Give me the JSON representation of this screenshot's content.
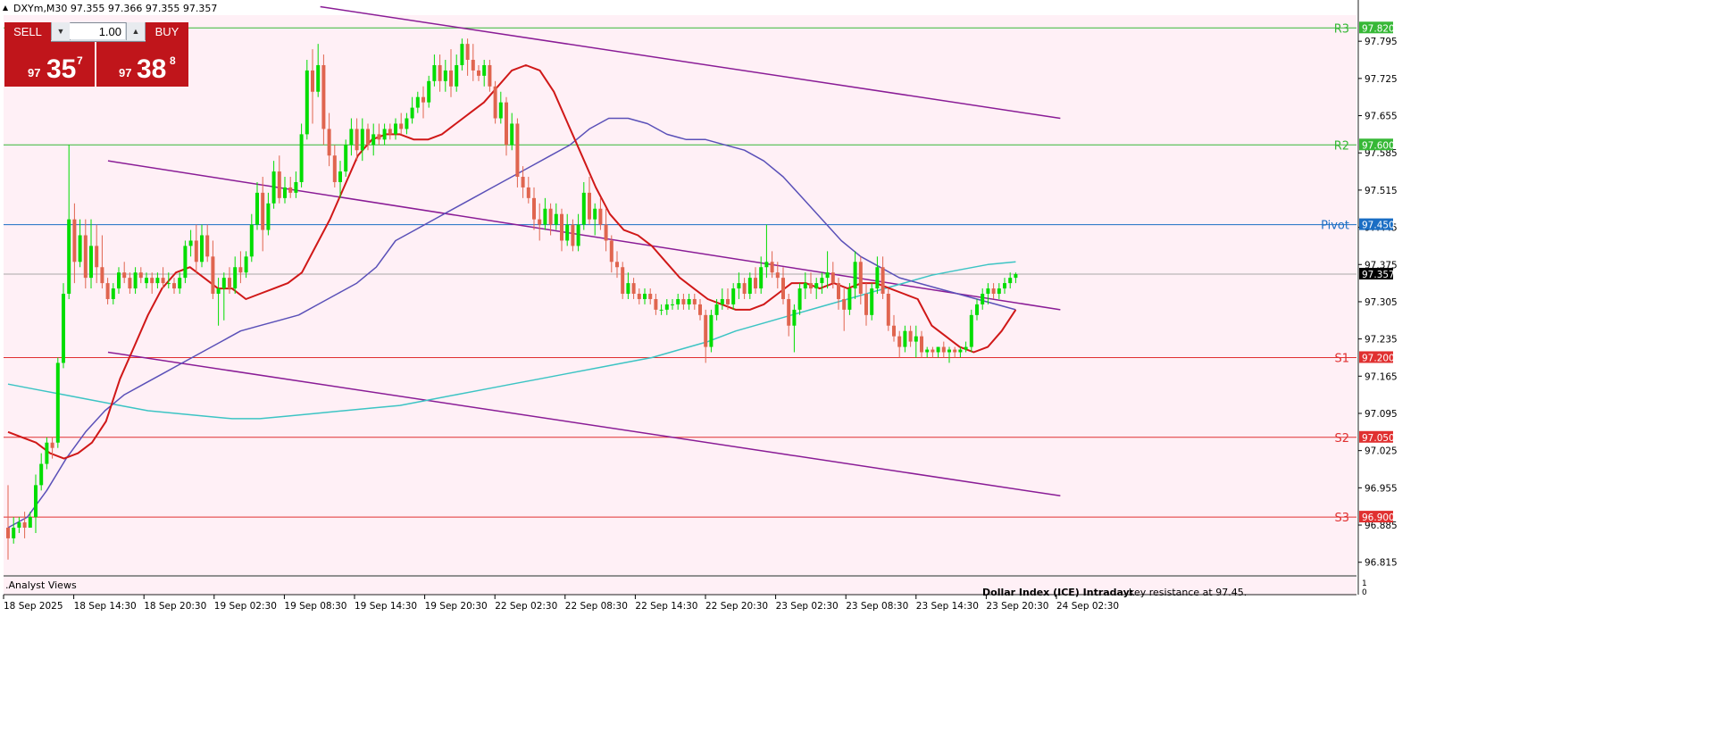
{
  "symbol_info": "DXYm,M30  97.355 97.366 97.355 97.357",
  "trade_panel": {
    "sell_label": "SELL",
    "buy_label": "BUY",
    "lot": "1.00",
    "sell_small": "97",
    "sell_big": "35",
    "sell_sup": "7",
    "buy_small": "97",
    "buy_big": "38",
    "buy_sup": "8"
  },
  "indicator_label": ".Analyst Views",
  "bottom_note": {
    "bold": "Dollar Index (ICE) Intraday:",
    "text": "key resistance at 97.45."
  },
  "colors": {
    "background": "#fff0f6",
    "bull": "#00dd00",
    "bear": "#e0654f",
    "ma_fast": "#d01818",
    "ma_mid": "#5a50b8",
    "ma_slow": "#3cc4c4",
    "channel": "#8a1c96",
    "resistance": "#36b836",
    "pivot": "#1a6ec4",
    "support": "#e03030"
  },
  "chart_data": {
    "type": "candlestick",
    "y_ticks": [
      97.795,
      97.725,
      97.655,
      97.585,
      97.515,
      97.445,
      97.375,
      97.305,
      97.235,
      97.165,
      97.095,
      97.025,
      96.955,
      96.885,
      96.815
    ],
    "ylim": [
      96.791,
      97.844
    ],
    "x_labels": [
      "18 Sep 2025",
      "18 Sep 14:30",
      "18 Sep 20:30",
      "19 Sep 02:30",
      "19 Sep 08:30",
      "19 Sep 14:30",
      "19 Sep 20:30",
      "22 Sep 02:30",
      "22 Sep 08:30",
      "22 Sep 14:30",
      "22 Sep 20:30",
      "23 Sep 02:30",
      "23 Sep 08:30",
      "23 Sep 14:30",
      "23 Sep 20:30",
      "24 Sep 02:30"
    ],
    "levels": [
      {
        "name": "R3",
        "value": 97.82,
        "price_label": "97.820",
        "kind": "resistance"
      },
      {
        "name": "R2",
        "value": 97.6,
        "price_label": "97.600",
        "kind": "resistance"
      },
      {
        "name": "Pivot",
        "value": 97.45,
        "price_label": "97.450",
        "kind": "pivot"
      },
      {
        "name": "S1",
        "value": 97.2,
        "price_label": "97.200",
        "kind": "support"
      },
      {
        "name": "S2",
        "value": 97.05,
        "price_label": "97.050",
        "kind": "support"
      },
      {
        "name": "S3",
        "value": 96.9,
        "price_label": "96.900",
        "kind": "support"
      }
    ],
    "current_price": 97.357,
    "current_price_label": "97.357",
    "candles": [
      [
        96.88,
        96.96,
        96.82,
        96.86
      ],
      [
        96.86,
        96.9,
        96.85,
        96.88
      ],
      [
        96.88,
        96.9,
        96.87,
        96.89
      ],
      [
        96.89,
        96.91,
        96.86,
        96.88
      ],
      [
        96.88,
        96.91,
        96.88,
        96.9
      ],
      [
        96.9,
        96.98,
        96.87,
        96.96
      ],
      [
        96.96,
        97.02,
        96.95,
        97.0
      ],
      [
        97.0,
        97.05,
        96.99,
        97.04
      ],
      [
        97.04,
        97.05,
        97.01,
        97.03
      ],
      [
        97.04,
        97.2,
        97.03,
        97.19
      ],
      [
        97.19,
        97.34,
        97.18,
        97.32
      ],
      [
        97.32,
        97.6,
        97.31,
        97.46
      ],
      [
        97.46,
        97.49,
        97.34,
        97.38
      ],
      [
        97.38,
        97.46,
        97.37,
        97.43
      ],
      [
        97.43,
        97.46,
        97.33,
        97.35
      ],
      [
        97.35,
        97.46,
        97.33,
        97.41
      ],
      [
        97.41,
        97.45,
        97.34,
        97.37
      ],
      [
        97.37,
        97.43,
        97.33,
        97.34
      ],
      [
        97.34,
        97.35,
        97.3,
        97.31
      ],
      [
        97.31,
        97.34,
        97.3,
        97.33
      ],
      [
        97.33,
        97.37,
        97.32,
        97.36
      ],
      [
        97.36,
        97.38,
        97.34,
        97.35
      ],
      [
        97.35,
        97.36,
        97.32,
        97.33
      ],
      [
        97.33,
        97.37,
        97.32,
        97.36
      ],
      [
        97.36,
        97.37,
        97.34,
        97.35
      ],
      [
        97.34,
        97.36,
        97.33,
        97.35
      ],
      [
        97.35,
        97.36,
        97.32,
        97.34
      ],
      [
        97.34,
        97.36,
        97.33,
        97.35
      ],
      [
        97.35,
        97.37,
        97.33,
        97.34
      ],
      [
        97.34,
        97.36,
        97.33,
        97.34
      ],
      [
        97.34,
        97.35,
        97.32,
        97.33
      ],
      [
        97.33,
        97.36,
        97.32,
        97.35
      ],
      [
        97.35,
        97.42,
        97.34,
        97.41
      ],
      [
        97.41,
        97.44,
        97.39,
        97.42
      ],
      [
        97.42,
        97.45,
        97.36,
        97.38
      ],
      [
        97.38,
        97.45,
        97.37,
        97.43
      ],
      [
        97.43,
        97.45,
        97.38,
        97.39
      ],
      [
        97.39,
        97.42,
        97.31,
        97.32
      ],
      [
        97.32,
        97.35,
        97.26,
        97.33
      ],
      [
        97.33,
        97.36,
        97.27,
        97.35
      ],
      [
        97.35,
        97.37,
        97.32,
        97.33
      ],
      [
        97.33,
        97.39,
        97.32,
        97.37
      ],
      [
        97.37,
        97.4,
        97.34,
        97.36
      ],
      [
        97.36,
        97.4,
        97.35,
        97.39
      ],
      [
        97.39,
        97.47,
        97.38,
        97.45
      ],
      [
        97.45,
        97.53,
        97.44,
        97.51
      ],
      [
        97.51,
        97.54,
        97.4,
        97.44
      ],
      [
        97.44,
        97.51,
        97.43,
        97.49
      ],
      [
        97.49,
        97.57,
        97.48,
        97.55
      ],
      [
        97.55,
        97.58,
        97.49,
        97.5
      ],
      [
        97.5,
        97.54,
        97.49,
        97.52
      ],
      [
        97.52,
        97.54,
        97.5,
        97.51
      ],
      [
        97.51,
        97.55,
        97.5,
        97.53
      ],
      [
        97.53,
        97.64,
        97.52,
        97.62
      ],
      [
        97.62,
        97.76,
        97.61,
        97.74
      ],
      [
        97.74,
        97.78,
        97.64,
        97.7
      ],
      [
        97.7,
        97.79,
        97.69,
        97.75
      ],
      [
        97.75,
        97.77,
        97.6,
        97.63
      ],
      [
        97.63,
        97.66,
        97.56,
        97.58
      ],
      [
        97.58,
        97.6,
        97.52,
        97.53
      ],
      [
        97.53,
        97.57,
        97.5,
        97.55
      ],
      [
        97.55,
        97.61,
        97.54,
        97.6
      ],
      [
        97.6,
        97.65,
        97.58,
        97.63
      ],
      [
        97.63,
        97.65,
        97.57,
        97.59
      ],
      [
        97.59,
        97.65,
        97.57,
        97.63
      ],
      [
        97.63,
        97.64,
        97.59,
        97.6
      ],
      [
        97.6,
        97.64,
        97.58,
        97.62
      ],
      [
        97.62,
        97.64,
        97.6,
        97.61
      ],
      [
        97.61,
        97.64,
        97.6,
        97.63
      ],
      [
        97.63,
        97.64,
        97.61,
        97.62
      ],
      [
        97.62,
        97.65,
        97.61,
        97.64
      ],
      [
        97.64,
        97.66,
        97.62,
        97.63
      ],
      [
        97.63,
        97.66,
        97.62,
        97.65
      ],
      [
        97.65,
        97.69,
        97.64,
        97.67
      ],
      [
        97.67,
        97.7,
        97.66,
        97.69
      ],
      [
        97.69,
        97.71,
        97.65,
        97.68
      ],
      [
        97.68,
        97.73,
        97.67,
        97.72
      ],
      [
        97.72,
        97.77,
        97.71,
        97.75
      ],
      [
        97.75,
        97.77,
        97.7,
        97.72
      ],
      [
        97.72,
        97.76,
        97.7,
        97.74
      ],
      [
        97.74,
        97.78,
        97.69,
        97.71
      ],
      [
        97.71,
        97.77,
        97.7,
        97.75
      ],
      [
        97.75,
        97.8,
        97.74,
        97.79
      ],
      [
        97.79,
        97.8,
        97.73,
        97.76
      ],
      [
        97.76,
        97.79,
        97.72,
        97.74
      ],
      [
        97.74,
        97.75,
        97.72,
        97.73
      ],
      [
        97.73,
        97.76,
        97.71,
        97.75
      ],
      [
        97.75,
        97.76,
        97.7,
        97.71
      ],
      [
        97.71,
        97.72,
        97.64,
        97.65
      ],
      [
        97.65,
        97.7,
        97.64,
        97.68
      ],
      [
        97.68,
        97.69,
        97.58,
        97.6
      ],
      [
        97.6,
        97.66,
        97.59,
        97.64
      ],
      [
        97.64,
        97.65,
        97.52,
        97.54
      ],
      [
        97.54,
        97.56,
        97.5,
        97.52
      ],
      [
        97.52,
        97.54,
        97.49,
        97.5
      ],
      [
        97.5,
        97.52,
        97.44,
        97.46
      ],
      [
        97.46,
        97.49,
        97.42,
        97.45
      ],
      [
        97.45,
        97.5,
        97.44,
        97.48
      ],
      [
        97.48,
        97.49,
        97.43,
        97.45
      ],
      [
        97.45,
        97.49,
        97.44,
        97.47
      ],
      [
        97.47,
        97.48,
        97.4,
        97.42
      ],
      [
        97.42,
        97.47,
        97.41,
        97.45
      ],
      [
        97.45,
        97.46,
        97.4,
        97.41
      ],
      [
        97.41,
        97.47,
        97.4,
        97.45
      ],
      [
        97.45,
        97.53,
        97.44,
        97.51
      ],
      [
        97.51,
        97.54,
        97.45,
        97.46
      ],
      [
        97.46,
        97.49,
        97.43,
        97.48
      ],
      [
        97.48,
        97.5,
        97.44,
        97.45
      ],
      [
        97.45,
        97.48,
        97.4,
        97.42
      ],
      [
        97.42,
        97.43,
        97.36,
        97.38
      ],
      [
        97.38,
        97.4,
        97.35,
        97.37
      ],
      [
        97.37,
        97.38,
        97.31,
        97.32
      ],
      [
        97.32,
        97.36,
        97.31,
        97.34
      ],
      [
        97.34,
        97.35,
        97.31,
        97.32
      ],
      [
        97.32,
        97.33,
        97.3,
        97.31
      ],
      [
        97.31,
        97.33,
        97.3,
        97.32
      ],
      [
        97.32,
        97.33,
        97.3,
        97.31
      ],
      [
        97.31,
        97.32,
        97.28,
        97.29
      ],
      [
        97.29,
        97.3,
        97.28,
        97.29
      ],
      [
        97.29,
        97.31,
        97.28,
        97.3
      ],
      [
        97.3,
        97.31,
        97.29,
        97.3
      ],
      [
        97.3,
        97.32,
        97.29,
        97.31
      ],
      [
        97.31,
        97.32,
        97.29,
        97.3
      ],
      [
        97.3,
        97.32,
        97.29,
        97.31
      ],
      [
        97.31,
        97.32,
        97.29,
        97.3
      ],
      [
        97.3,
        97.31,
        97.27,
        97.28
      ],
      [
        97.28,
        97.29,
        97.19,
        97.22
      ],
      [
        97.22,
        97.29,
        97.21,
        97.28
      ],
      [
        97.28,
        97.31,
        97.27,
        97.3
      ],
      [
        97.3,
        97.33,
        97.29,
        97.31
      ],
      [
        97.31,
        97.33,
        97.29,
        97.3
      ],
      [
        97.3,
        97.34,
        97.29,
        97.33
      ],
      [
        97.33,
        97.36,
        97.31,
        97.34
      ],
      [
        97.34,
        97.35,
        97.31,
        97.32
      ],
      [
        97.32,
        97.36,
        97.31,
        97.35
      ],
      [
        97.35,
        97.37,
        97.32,
        97.33
      ],
      [
        97.33,
        97.39,
        97.32,
        97.37
      ],
      [
        97.37,
        97.45,
        97.35,
        97.38
      ],
      [
        97.38,
        97.4,
        97.35,
        97.36
      ],
      [
        97.36,
        97.38,
        97.33,
        97.35
      ],
      [
        97.35,
        97.37,
        97.3,
        97.31
      ],
      [
        97.31,
        97.32,
        97.24,
        97.26
      ],
      [
        97.26,
        97.3,
        97.21,
        97.29
      ],
      [
        97.29,
        97.34,
        97.28,
        97.33
      ],
      [
        97.33,
        97.36,
        97.31,
        97.34
      ],
      [
        97.34,
        97.36,
        97.32,
        97.33
      ],
      [
        97.33,
        97.35,
        97.31,
        97.34
      ],
      [
        97.34,
        97.36,
        97.32,
        97.35
      ],
      [
        97.35,
        97.4,
        97.33,
        97.36
      ],
      [
        97.36,
        97.38,
        97.33,
        97.34
      ],
      [
        97.34,
        97.35,
        97.29,
        97.31
      ],
      [
        97.31,
        97.33,
        97.25,
        97.29
      ],
      [
        97.29,
        97.34,
        97.28,
        97.33
      ],
      [
        97.33,
        97.4,
        97.31,
        97.38
      ],
      [
        97.38,
        97.39,
        97.3,
        97.32
      ],
      [
        97.32,
        97.34,
        97.26,
        97.28
      ],
      [
        97.28,
        97.34,
        97.27,
        97.33
      ],
      [
        97.33,
        97.39,
        97.32,
        97.37
      ],
      [
        97.37,
        97.39,
        97.31,
        97.32
      ],
      [
        97.32,
        97.33,
        97.25,
        97.26
      ],
      [
        97.26,
        97.28,
        97.23,
        97.24
      ],
      [
        97.24,
        97.25,
        97.2,
        97.22
      ],
      [
        97.22,
        97.26,
        97.21,
        97.25
      ],
      [
        97.25,
        97.26,
        97.22,
        97.23
      ],
      [
        97.23,
        97.26,
        97.2,
        97.24
      ],
      [
        97.24,
        97.25,
        97.2,
        97.21
      ],
      [
        97.21,
        97.22,
        97.2,
        97.215
      ],
      [
        97.215,
        97.22,
        97.2,
        97.21
      ],
      [
        97.21,
        97.22,
        97.2,
        97.22
      ],
      [
        97.22,
        97.23,
        97.2,
        97.21
      ],
      [
        97.21,
        97.22,
        97.19,
        97.215
      ],
      [
        97.215,
        97.22,
        97.2,
        97.21
      ],
      [
        97.21,
        97.22,
        97.2,
        97.215
      ],
      [
        97.215,
        97.23,
        97.21,
        97.22
      ],
      [
        97.22,
        97.29,
        97.21,
        97.28
      ],
      [
        97.28,
        97.31,
        97.27,
        97.3
      ],
      [
        97.3,
        97.33,
        97.29,
        97.32
      ],
      [
        97.32,
        97.34,
        97.3,
        97.33
      ],
      [
        97.33,
        97.34,
        97.31,
        97.32
      ],
      [
        97.32,
        97.34,
        97.31,
        97.33
      ],
      [
        97.33,
        97.35,
        97.32,
        97.34
      ],
      [
        97.34,
        97.36,
        97.33,
        97.35
      ],
      [
        97.35,
        97.36,
        97.34,
        97.357
      ]
    ],
    "indicators": {
      "ma_fast": [
        97.06,
        97.05,
        97.04,
        97.02,
        97.01,
        97.02,
        97.04,
        97.08,
        97.16,
        97.22,
        97.28,
        97.33,
        97.36,
        97.37,
        97.35,
        97.33,
        97.33,
        97.31,
        97.32,
        97.33,
        97.34,
        97.36,
        97.41,
        97.46,
        97.52,
        97.58,
        97.61,
        97.62,
        97.62,
        97.61,
        97.61,
        97.62,
        97.64,
        97.66,
        97.68,
        97.71,
        97.74,
        97.75,
        97.74,
        97.7,
        97.64,
        97.58,
        97.52,
        97.47,
        97.44,
        97.43,
        97.41,
        97.38,
        97.35,
        97.33,
        97.31,
        97.3,
        97.29,
        97.29,
        97.3,
        97.32,
        97.34,
        97.34,
        97.33,
        97.34,
        97.33,
        97.34,
        97.34,
        97.33,
        97.32,
        97.31,
        97.26,
        97.24,
        97.22,
        97.21,
        97.22,
        97.25,
        97.29
      ],
      "ma_mid": [
        96.88,
        96.9,
        96.95,
        97.01,
        97.06,
        97.1,
        97.13,
        97.15,
        97.17,
        97.19,
        97.21,
        97.23,
        97.25,
        97.26,
        97.27,
        97.28,
        97.3,
        97.32,
        97.34,
        97.37,
        97.42,
        97.44,
        97.46,
        97.48,
        97.5,
        97.52,
        97.54,
        97.56,
        97.58,
        97.6,
        97.63,
        97.65,
        97.65,
        97.64,
        97.62,
        97.61,
        97.61,
        97.6,
        97.59,
        97.57,
        97.54,
        97.5,
        97.46,
        97.42,
        97.39,
        97.37,
        97.35,
        97.34,
        97.33,
        97.32,
        97.31,
        97.3,
        97.29
      ],
      "ma_slow": [
        97.15,
        97.14,
        97.13,
        97.12,
        97.11,
        97.1,
        97.095,
        97.09,
        97.085,
        97.085,
        97.09,
        97.095,
        97.1,
        97.105,
        97.11,
        97.12,
        97.13,
        97.14,
        97.15,
        97.16,
        97.17,
        97.18,
        97.19,
        97.2,
        97.215,
        97.23,
        97.25,
        97.265,
        97.28,
        97.295,
        97.31,
        97.325,
        97.34,
        97.355,
        97.365,
        97.375,
        97.38
      ]
    },
    "channels": [
      {
        "from": [
          0.2341,
          97.86
        ],
        "to": [
          0.7811,
          97.65
        ]
      },
      {
        "from": [
          0.0772,
          97.57
        ],
        "to": [
          0.7811,
          97.29
        ]
      },
      {
        "from": [
          0.0772,
          97.21
        ],
        "to": [
          0.7811,
          96.94
        ]
      }
    ]
  }
}
